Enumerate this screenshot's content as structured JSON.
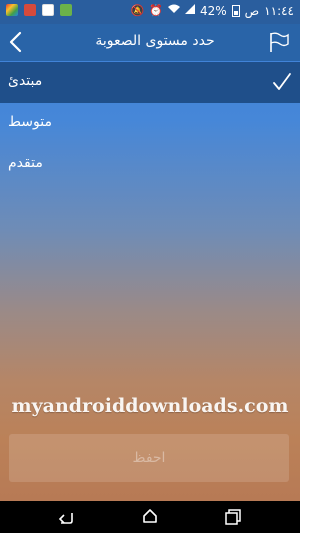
{
  "status_bar": {
    "time": "١١:٤٤",
    "period": "ص",
    "battery": "42%",
    "icons": [
      "mail-app-icon",
      "phone-app-icon",
      "photo-app-icon",
      "gallery-app-icon",
      "alarm-icon",
      "mute-icon",
      "wifi-icon",
      "signal-icon",
      "battery-icon"
    ]
  },
  "toolbar": {
    "title": "حدد مستوى الصعوبة",
    "back_icon": "chevron-left-icon",
    "flag_icon": "flag-icon"
  },
  "levels": [
    {
      "label": "مبتدئ",
      "selected": true
    },
    {
      "label": "متوسط",
      "selected": false
    },
    {
      "label": "متقدم",
      "selected": false
    }
  ],
  "watermark": "myandroiddownloads.com",
  "save_button": "احفظ",
  "nav": {
    "back_icon": "nav-back-icon",
    "home_icon": "nav-home-icon",
    "recent_icon": "nav-recent-icon"
  },
  "colors": {
    "toolbar": "#2964a8",
    "selected_row": "#1f4f8a",
    "status_bar": "#2a5e9e"
  }
}
